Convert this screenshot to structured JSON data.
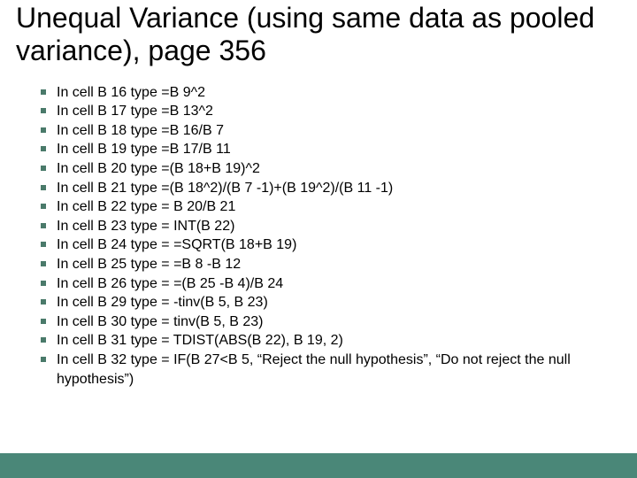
{
  "title": "Unequal Variance (using same data as pooled variance), page 356",
  "items": [
    "In cell B 16 type =B 9^2",
    "In cell B 17 type =B 13^2",
    "In cell B 18 type =B 16/B 7",
    "In cell B 19 type =B 17/B 11",
    "In cell B 20 type =(B 18+B 19)^2",
    "In cell B 21 type =(B 18^2)/(B 7 -1)+(B 19^2)/(B 11 -1)",
    "In cell B 22 type = B 20/B 21",
    "In cell B 23 type = INT(B 22)",
    "In cell B 24 type = =SQRT(B 18+B 19)",
    "In cell B 25 type = =B 8 -B 12",
    "In cell B 26 type = =(B 25 -B 4)/B 24",
    "In cell B 29 type = -tinv(B 5, B 23)",
    "In cell B 30 type = tinv(B 5, B 23)",
    "In cell B 31 type = TDIST(ABS(B 22), B 19, 2)",
    "In cell B 32 type = IF(B 27<B 5, “Reject the null hypothesis”, “Do not reject the null hypothesis”)"
  ],
  "colors": {
    "accent": "#4a8778",
    "bullet": "#4a7a6a"
  }
}
